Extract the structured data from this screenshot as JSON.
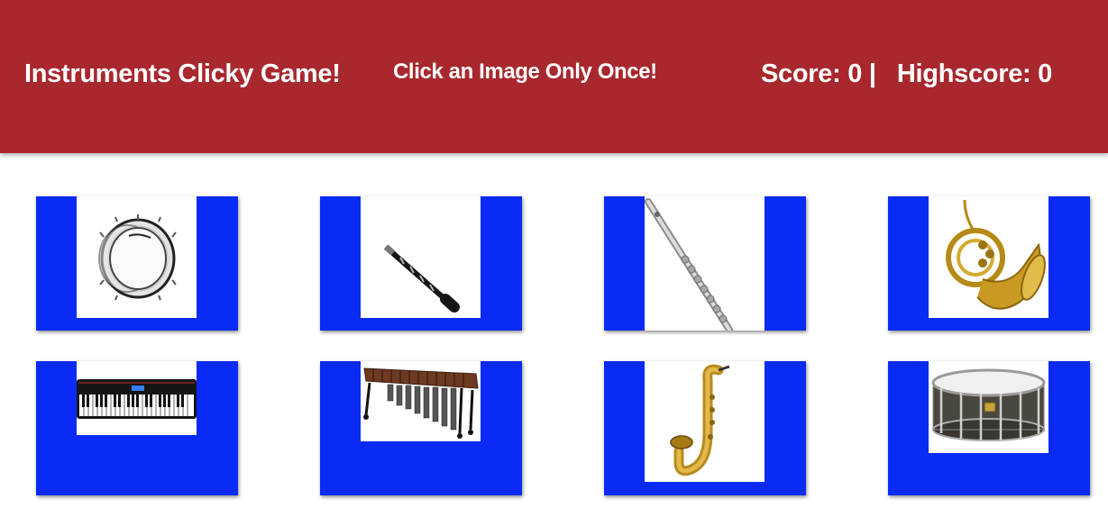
{
  "header": {
    "title": "Instruments Clicky Game!",
    "instruction": "Click an Image Only Once!",
    "score_label": "Score: ",
    "score": "0",
    "separator": " |   ",
    "highscore_label": "Highscore: ",
    "highscore": "0"
  },
  "colors": {
    "navbar": "#a8282e",
    "card": "#0a2bf5"
  },
  "cards": [
    {
      "instrument": "bass-drum-icon"
    },
    {
      "instrument": "clarinet-icon"
    },
    {
      "instrument": "flute-icon"
    },
    {
      "instrument": "french-horn-icon"
    },
    {
      "instrument": "keyboard-icon"
    },
    {
      "instrument": "marimba-icon"
    },
    {
      "instrument": "saxophone-icon"
    },
    {
      "instrument": "snare-drum-icon"
    }
  ]
}
